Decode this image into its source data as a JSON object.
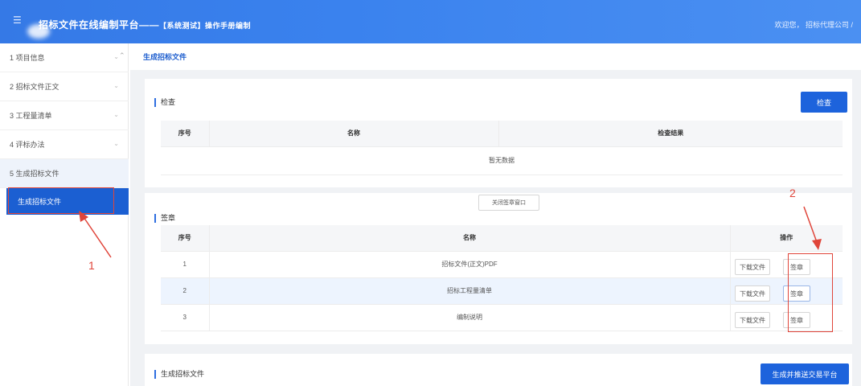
{
  "header": {
    "title": "招标文件在线编制平台",
    "separator": "——",
    "subtitle": "【系统测试】操作手册编制",
    "user_text": "欢迎您，  招标代理公司 /"
  },
  "sidebar": {
    "items": [
      {
        "label": "1 项目信息"
      },
      {
        "label": "2 招标文件正文"
      },
      {
        "label": "3 工程量清单"
      },
      {
        "label": "4 评标办法"
      },
      {
        "label": "5 生成招标文件"
      }
    ],
    "active_sub": "生成招标文件"
  },
  "annotations": {
    "one": "1",
    "two": "2"
  },
  "main": {
    "breadcrumb": "生成招标文件",
    "check_section": {
      "title": "检查",
      "button": "检查",
      "columns": [
        "序号",
        "名称",
        "检查结果"
      ],
      "empty_text": "暂无数据"
    },
    "sign_section": {
      "title": "签章",
      "floating_button": "关闭签章窗口",
      "columns": [
        "序号",
        "名称",
        "操作"
      ],
      "rows": [
        {
          "no": "1",
          "name": "招标文件(正文)PDF",
          "download": "下载文件",
          "sign": "签章"
        },
        {
          "no": "2",
          "name": "招标工程量清单",
          "download": "下载文件",
          "sign": "签章"
        },
        {
          "no": "3",
          "name": "编制说明",
          "download": "下载文件",
          "sign": "签章"
        }
      ]
    },
    "generate_section": {
      "title": "生成招标文件",
      "button": "生成并推送交易平台"
    }
  },
  "colors": {
    "header": "#3579e6",
    "primary": "#1d63dc",
    "annotation": "#e0453a",
    "highlight_row": "#edf4fe"
  }
}
